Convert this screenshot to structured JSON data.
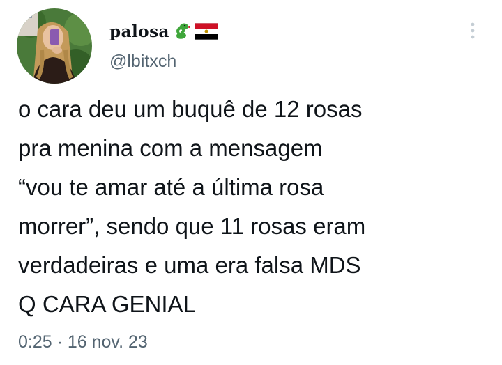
{
  "tweet": {
    "display_name": "palosa",
    "name_emojis": [
      "snake-emoji",
      "egypt-flag-emoji"
    ],
    "handle": "@lbitxch",
    "text": "o cara deu um buquê de 12 rosas\npra menina com a mensagem\n“vou te amar até a última rosa\nmorrer”, sendo que 11 rosas eram\nverdadeiras e uma era falsa MDS\nQ CARA GENIAL",
    "timestamp": "0:25 · 16 nov. 23",
    "more_icon": "more-vertical-icon"
  },
  "colors": {
    "text_primary": "#0f1419",
    "text_secondary": "#536471",
    "background": "#ffffff",
    "snake_green": "#3fa63a",
    "flag_red": "#ce1126",
    "flag_gold": "#c09300"
  }
}
